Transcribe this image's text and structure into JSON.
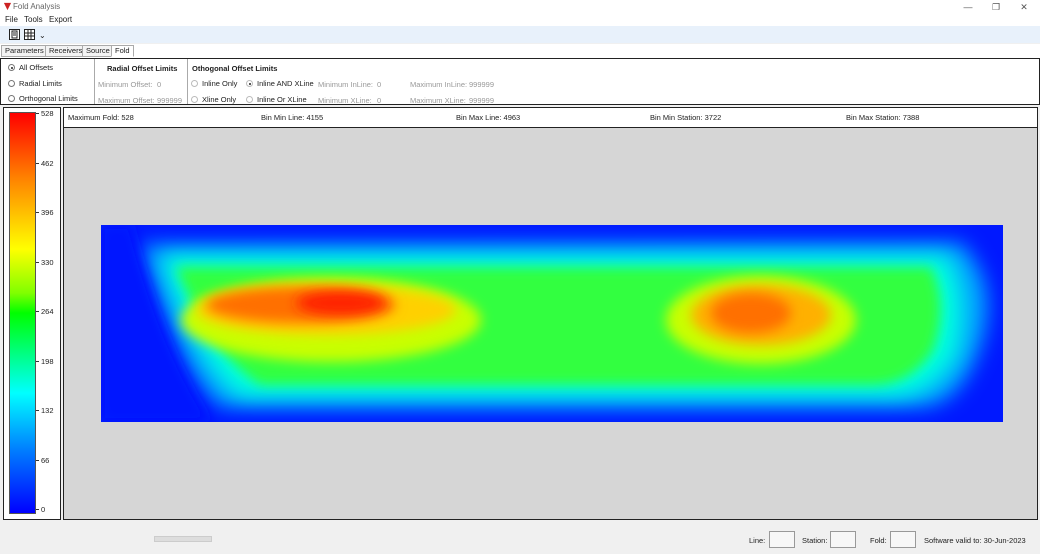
{
  "window": {
    "title": "Fold Analysis",
    "min": "—",
    "max": "❐",
    "close": "✕"
  },
  "menu": {
    "file": "File",
    "tools": "Tools",
    "export": "Export"
  },
  "toolbar": {
    "arrow": "⌄"
  },
  "tabs": [
    "Parameters",
    "Receivers",
    "Source",
    "Fold"
  ],
  "options": {
    "mode": {
      "all": "All Offsets",
      "radial": "Radial Limits",
      "orthogonal": "Orthogonal Limits",
      "selected": "all"
    },
    "radial": {
      "title": "Radial Offset Limits",
      "min_label": "Minimum Offset:",
      "min_value": "0",
      "max_label": "Maximum Offset:",
      "max_value": "999999"
    },
    "orthogonal": {
      "title": "Othogonal Offset Limits",
      "inline_only": "Inline Only",
      "xline_only": "Xline Only",
      "inline_and_xline": "Inline AND XLine",
      "inline_or_xline": "Inline Or XLine",
      "selected": "inline_and_xline",
      "min_inline_label": "Minimum InLine:",
      "min_inline_value": "0",
      "max_inline_label": "Maximum InLine:",
      "max_inline_value": "999999",
      "min_xline_label": "Minimum XLine:",
      "min_xline_value": "0",
      "max_xline_label": "Maximum XLine:",
      "max_xline_value": "999999"
    }
  },
  "legend": {
    "ticks": [
      "528",
      "462",
      "396",
      "330",
      "264",
      "198",
      "132",
      "66",
      "0"
    ],
    "max": 528,
    "min": 0
  },
  "info": {
    "max_fold": "Maximum Fold: 528",
    "bin_min_line": "Bin Min Line: 4155",
    "bin_max_line": "Bin Max Line: 4963",
    "bin_min_station": "Bin Min Station: 3722",
    "bin_max_station": "Bin Max Station: 7388"
  },
  "status": {
    "line_label": "Line:",
    "station_label": "Station:",
    "fold_label": "Fold:",
    "line_value": "",
    "station_value": "",
    "fold_value": "",
    "valid": "Software valid to: 30-Jun-2023"
  },
  "colors": {
    "accent": "#cc2222",
    "plot_bg": "#d6d6d6",
    "toolbar_bg": "#e8f1fb"
  }
}
